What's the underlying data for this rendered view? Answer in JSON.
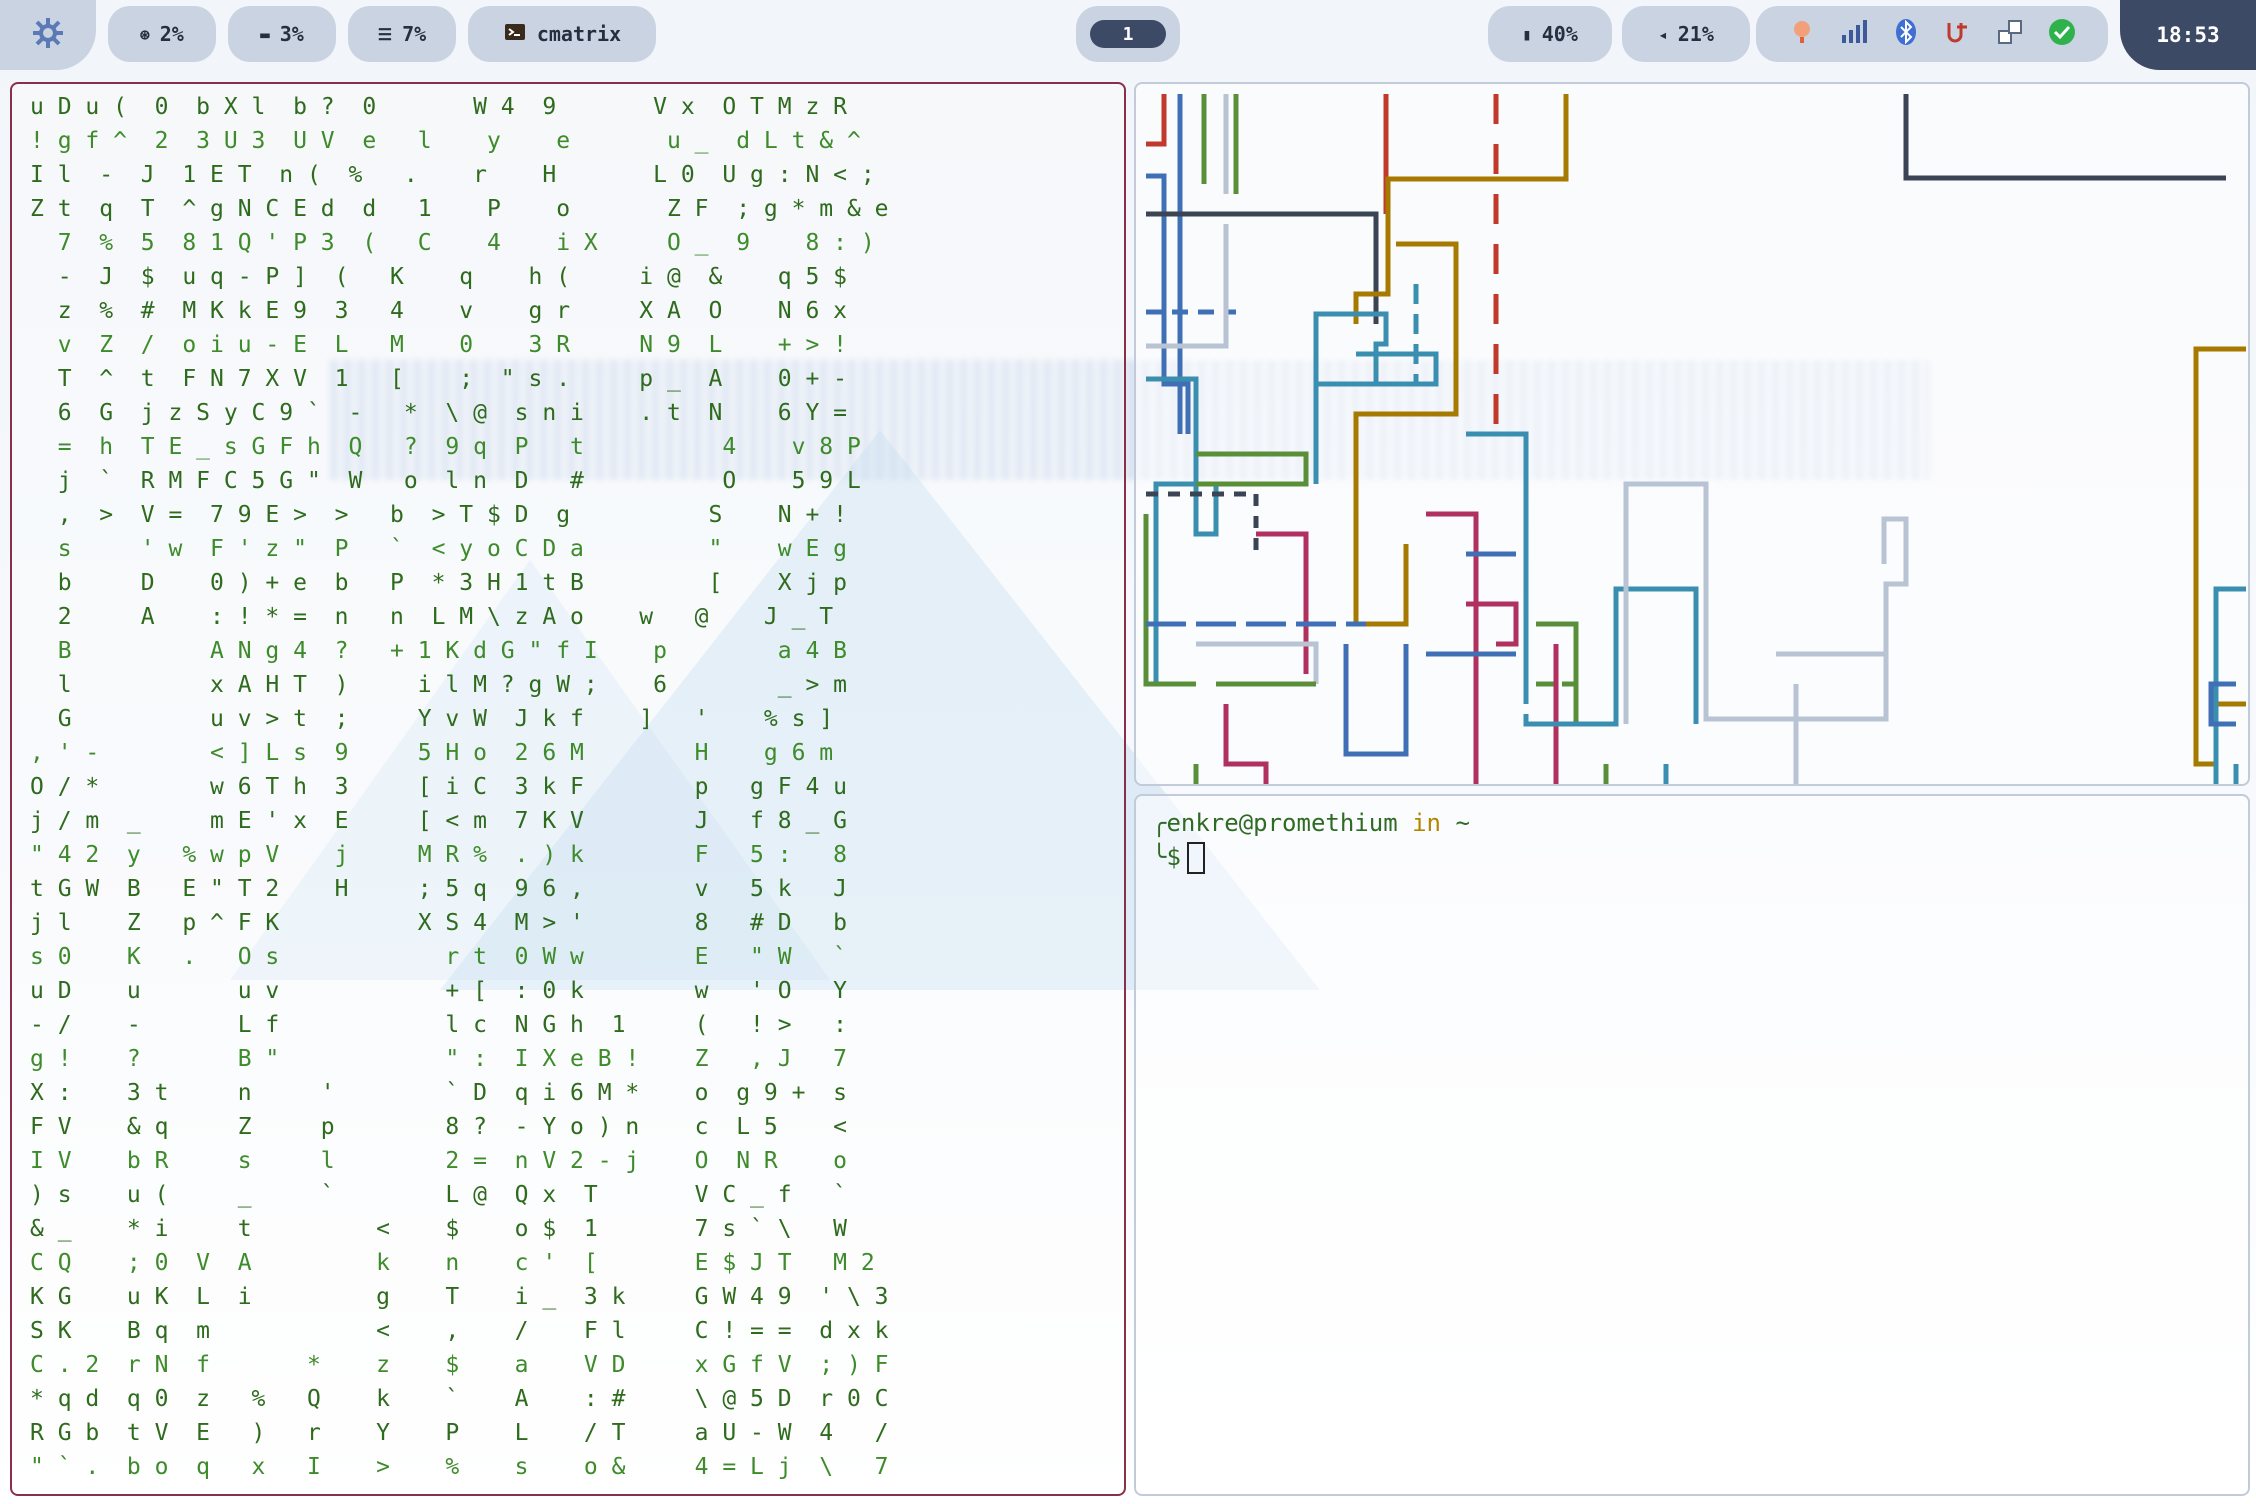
{
  "bar": {
    "cpu": "2%",
    "memory": "3%",
    "disk": "7%",
    "window_title": "cmatrix",
    "workspace": "1",
    "battery": "40%",
    "volume": "21%",
    "clock": "18:53"
  },
  "icons": {
    "logo": "nixos-snowflake-icon",
    "cpu": "cpu-icon",
    "memory": "memory-icon",
    "disk": "disk-icon",
    "window": "terminal-app-icon",
    "battery": "battery-icon",
    "volume": "volume-icon",
    "tray": [
      "weather-icon",
      "network-signal-icon",
      "bluetooth-icon",
      "vpn-icon",
      "package-update-icon",
      "check-icon"
    ]
  },
  "matrix": {
    "lines": [
      "u D u (  0  b X l  b ?  0       W 4  9       V x  O T M z R",
      "! g f ^  2  3 U 3  U V  e   l    y    e       u _  d L t & ^",
      "I l  -  J  1 E T  n (  %   .    r    H       L 0  U g : N < ;",
      "Z t  q  T  ^ g N C E d  d   1    P    o       Z F  ; g * m & e",
      "  7  %  5  8 1 Q ' P 3  (   C    4    i X     O _  9    8 : )",
      "  -  J  $  u q - P ]  (   K    q    h (     i @  &    q 5 $",
      "  z  %  #  M K k E 9  3   4    v    g r     X A  O    N 6 x",
      "  v  Z  /  o i u - E  L   M    0    3 R     N 9  L    + > !",
      "  T  ^  t  F N 7 X V  1   [    ;  \" s .     p _  A    0 + -",
      "  6  G  j z S y C 9 `  -   *  \\ @  s n i    . t  N    6 Y =",
      "  =  h  T E _ s G F h  Q   ?  9 q  P   t          4    v 8 P",
      "  j  `  R M F C 5 G \"  W   o  l n  D   #          O    5 9 L",
      "  ,  >  V =  7 9 E >  >   b  > T $ D  g          S    N + !",
      "  s     ' w  F ' z \"  P   `  < y o C D a         \"    w E g",
      "  b     D    0 ) + e  b   P  * 3 H 1 t B         [    X j p",
      "  2     A    : ! * =  n   n  L M \\ z A o    w   @    J _ T",
      "  B          A N g 4  ?   + 1 K d G \" f I    p        a 4 B",
      "  l          x A H T  )     i l M ? g W ;    6        _ > m",
      "  G          u v > t  ;     Y v W  J k f    ]   '    % s ]",
      ", ' -        < ] L s  9     5 H o  2 6 M        H    g 6 m",
      "O / *        w 6 T h  3     [ i C  3 k F        p   g F 4 u",
      "j / m  _     m E ' x  E     [ < m  7 K V        J   f 8 _ G",
      "\" 4 2  y   % w p V    j     M R %  . ) k        F   5 :   8",
      "t G W  B   E \" T 2    H     ; 5 q  9 6 ,        v   5 k   J",
      "j l    Z   p ^ F K          X S 4  M > '        8   # D   b",
      "s 0    K   .   O s            r t  0 W w        E   \" W   `",
      "u D    u       u v            + [  : 0 k        w   ' O   Y",
      "- /    -       L f            l c  N G h  1     (   ! >   :",
      "g !    ?       B \"            \" :  I X e B !    Z   , J   7",
      "X :    3 t     n     '        ` D  q i 6 M *    o  g 9 +  s",
      "F V    & q     Z     p        8 ?  - Y o ) n    c  L 5    <",
      "I V    b R     s     l        2 =  n V 2 - j    O  N R    o",
      ") s    u (     _     `        L @  Q x  T       V C _ f   `",
      "& _    * i     t         <    $    o $  1       7 s ` \\   W",
      "C Q    ; 0  V  A         k    n    c '  [       E $ J T   M 2",
      "K G    u K  L  i         g    T    i _  3 k     G W 4 9  ' \\ 3",
      "S K    B q  m            <    ,    /    F l     C ! = =  d x k",
      "C . 2  r N  f       *    z    $    a    V D     x G f V  ; ) F",
      "* q d  q 0  z   %   Q    k    `    A    : #     \\ @ 5 D  r 0 C",
      "R G b  t V  E   )   r    Y    P    L    / T     a U - W  4   /",
      "\" ` .  b o  q   x   I    >    %    s    o &     4 = L j  \\   7"
    ]
  },
  "terminal": {
    "user_host": "enkre@promethium",
    "in_word": "in",
    "path": "~",
    "prompt_char": "$"
  }
}
